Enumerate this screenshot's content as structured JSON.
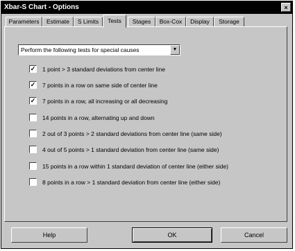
{
  "window": {
    "title": "Xbar-S Chart - Options",
    "close_glyph": "×"
  },
  "tabs": [
    {
      "label": "Parameters",
      "active": false
    },
    {
      "label": "Estimate",
      "active": false
    },
    {
      "label": "S Limits",
      "active": false
    },
    {
      "label": "Tests",
      "active": true
    },
    {
      "label": "Stages",
      "active": false
    },
    {
      "label": "Box-Cox",
      "active": false
    },
    {
      "label": "Display",
      "active": false
    },
    {
      "label": "Storage",
      "active": false
    }
  ],
  "test_mode": {
    "selected": "Perform the following tests for special causes",
    "arrow_glyph": "▼"
  },
  "tests": [
    {
      "label": "1 point > 3 standard deviations from center line",
      "checked": true
    },
    {
      "label": "7 points in a row on same side of center line",
      "checked": true
    },
    {
      "label": "7 points in a row, all increasing or all decreasing",
      "checked": true
    },
    {
      "label": "14 points in a row, alternating up and down",
      "checked": false
    },
    {
      "label": "2 out of 3 points > 2 standard deviations from center line (same side)",
      "checked": false
    },
    {
      "label": "4 out of 5 points > 1 standard deviation from center line (same side)",
      "checked": false
    },
    {
      "label": "15 points in a row within 1 standard deviation of center line (either side)",
      "checked": false
    },
    {
      "label": "8 points in a row > 1 standard deviation from center line (either side)",
      "checked": false
    }
  ],
  "check_glyph": "✓",
  "buttons": {
    "help": "Help",
    "ok": "OK",
    "cancel": "Cancel"
  }
}
